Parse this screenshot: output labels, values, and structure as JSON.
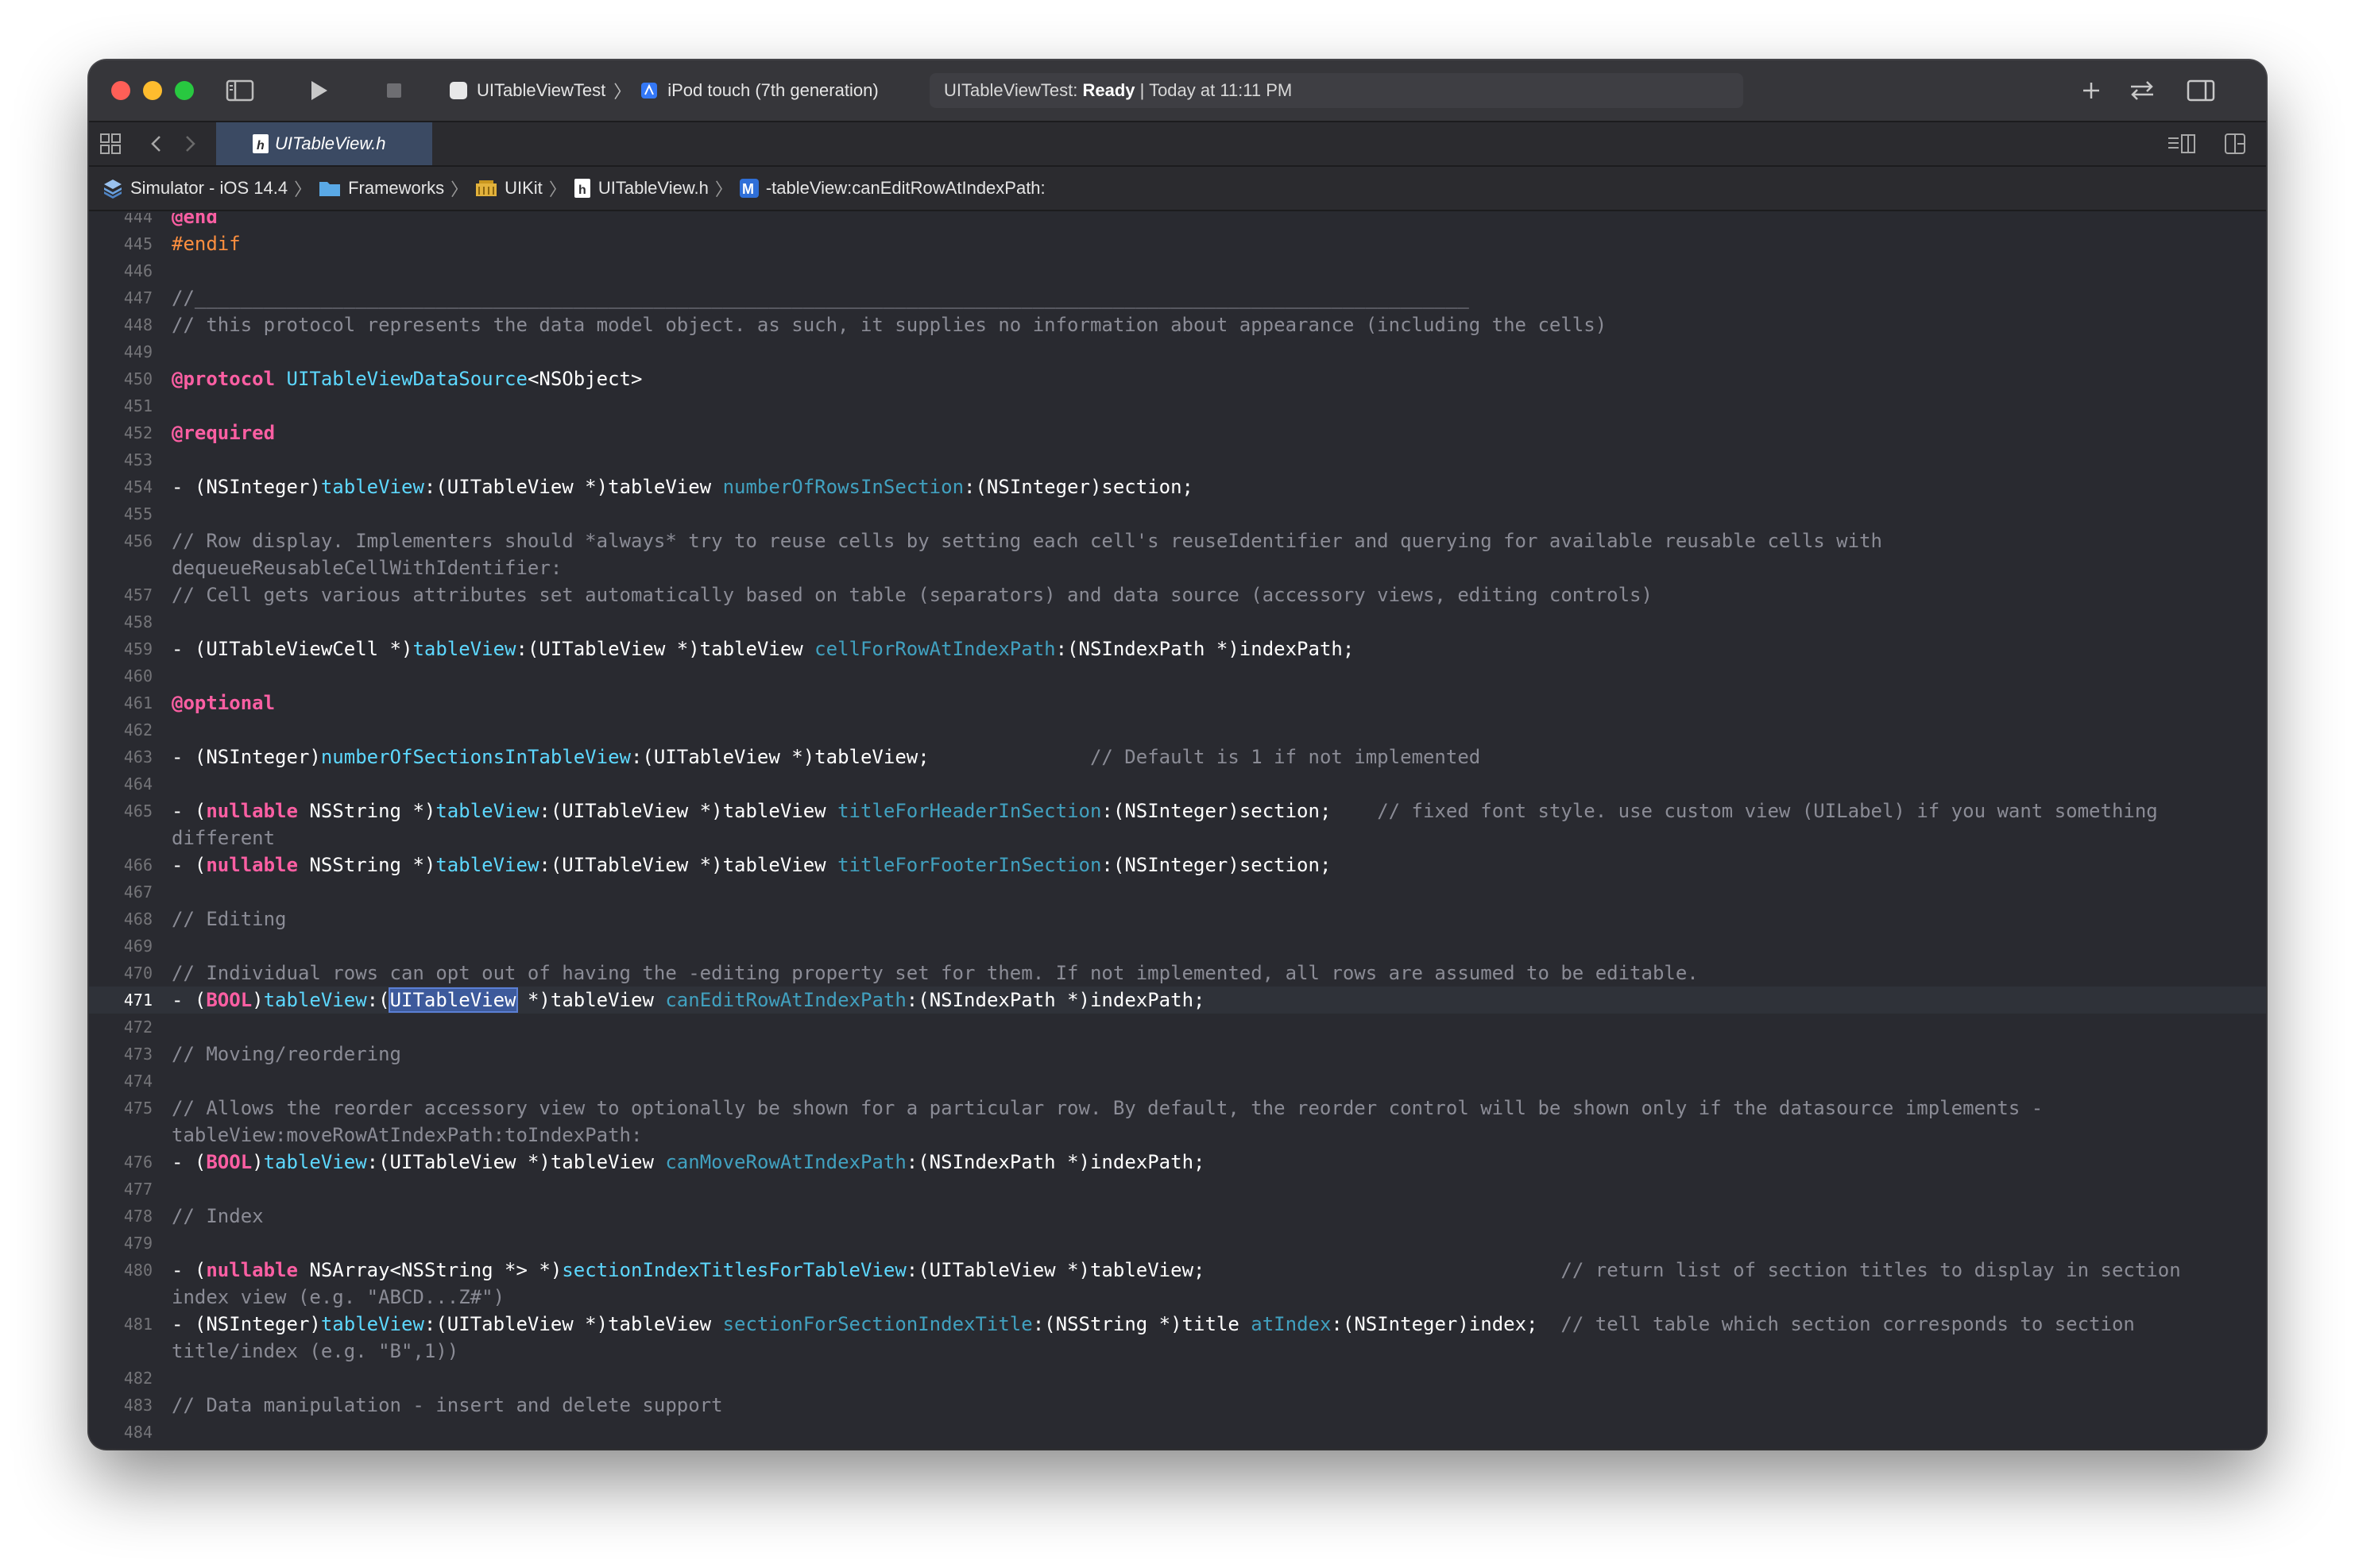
{
  "toolbar": {
    "scheme_target": "UITableViewTest",
    "device": "iPod touch (7th generation)",
    "activity_project": "UITableViewTest:",
    "activity_status": "Ready",
    "activity_time": "| Today at 11:11 PM",
    "icons": [
      "sidebar-toggle-icon",
      "run-icon",
      "stop-icon",
      "add-icon",
      "swap-icon",
      "inspector-toggle-icon"
    ]
  },
  "tabbar": {
    "active_tab": "UITableView.h",
    "icons": [
      "grid-icon",
      "back-icon",
      "forward-icon",
      "split-editor-icon",
      "add-editor-icon"
    ]
  },
  "jumpbar": {
    "items": [
      "Simulator - iOS 14.4",
      "Frameworks",
      "UIKit",
      "UITableView.h",
      "-tableView:canEditRowAtIndexPath:"
    ]
  },
  "editor": {
    "current_line": "471",
    "lines": [
      {
        "n": "444",
        "text": "@end"
      },
      {
        "n": "445",
        "text": "#endif"
      },
      {
        "n": "446",
        "text": ""
      },
      {
        "n": "447",
        "text": "//_______________________________________________________________________________________________________________"
      },
      {
        "n": "448",
        "text": "// this protocol represents the data model object. as such, it supplies no information about appearance (including the cells)"
      },
      {
        "n": "449",
        "text": ""
      },
      {
        "n": "450",
        "text": "@protocol UITableViewDataSource<NSObject>"
      },
      {
        "n": "451",
        "text": ""
      },
      {
        "n": "452",
        "text": "@required"
      },
      {
        "n": "453",
        "text": ""
      },
      {
        "n": "454",
        "text": "- (NSInteger)tableView:(UITableView *)tableView numberOfRowsInSection:(NSInteger)section;"
      },
      {
        "n": "455",
        "text": ""
      },
      {
        "n": "456",
        "text": "// Row display. Implementers should *always* try to reuse cells by setting each cell's reuseIdentifier and querying for available reusable cells with dequeueReusableCellWithIdentifier:"
      },
      {
        "n": "457",
        "text": "// Cell gets various attributes set automatically based on table (separators) and data source (accessory views, editing controls)"
      },
      {
        "n": "458",
        "text": ""
      },
      {
        "n": "459",
        "text": "- (UITableViewCell *)tableView:(UITableView *)tableView cellForRowAtIndexPath:(NSIndexPath *)indexPath;"
      },
      {
        "n": "460",
        "text": ""
      },
      {
        "n": "461",
        "text": "@optional"
      },
      {
        "n": "462",
        "text": ""
      },
      {
        "n": "463",
        "text": "- (NSInteger)numberOfSectionsInTableView:(UITableView *)tableView;              // Default is 1 if not implemented"
      },
      {
        "n": "464",
        "text": ""
      },
      {
        "n": "465",
        "text": "- (nullable NSString *)tableView:(UITableView *)tableView titleForHeaderInSection:(NSInteger)section;    // fixed font style. use custom view (UILabel) if you want something different"
      },
      {
        "n": "466",
        "text": "- (nullable NSString *)tableView:(UITableView *)tableView titleForFooterInSection:(NSInteger)section;"
      },
      {
        "n": "467",
        "text": ""
      },
      {
        "n": "468",
        "text": "// Editing"
      },
      {
        "n": "469",
        "text": ""
      },
      {
        "n": "470",
        "text": "// Individual rows can opt out of having the -editing property set for them. If not implemented, all rows are assumed to be editable."
      },
      {
        "n": "471",
        "text": "- (BOOL)tableView:(UITableView *)tableView canEditRowAtIndexPath:(NSIndexPath *)indexPath;"
      },
      {
        "n": "472",
        "text": ""
      },
      {
        "n": "473",
        "text": "// Moving/reordering"
      },
      {
        "n": "474",
        "text": ""
      },
      {
        "n": "475",
        "text": "// Allows the reorder accessory view to optionally be shown for a particular row. By default, the reorder control will be shown only if the datasource implements -tableView:moveRowAtIndexPath:toIndexPath:"
      },
      {
        "n": "476",
        "text": "- (BOOL)tableView:(UITableView *)tableView canMoveRowAtIndexPath:(NSIndexPath *)indexPath;"
      },
      {
        "n": "477",
        "text": ""
      },
      {
        "n": "478",
        "text": "// Index"
      },
      {
        "n": "479",
        "text": ""
      },
      {
        "n": "480",
        "text": "- (nullable NSArray<NSString *> *)sectionIndexTitlesForTableView:(UITableView *)tableView;                               // return list of section titles to display in section index view (e.g. \"ABCD...Z#\")"
      },
      {
        "n": "481",
        "text": "- (NSInteger)tableView:(UITableView *)tableView sectionForSectionIndexTitle:(NSString *)title atIndex:(NSInteger)index;  // tell table which section corresponds to section title/index (e.g. \"B\",1))"
      },
      {
        "n": "482",
        "text": ""
      },
      {
        "n": "483",
        "text": "// Data manipulation - insert and delete support"
      },
      {
        "n": "484",
        "text": ""
      }
    ]
  }
}
